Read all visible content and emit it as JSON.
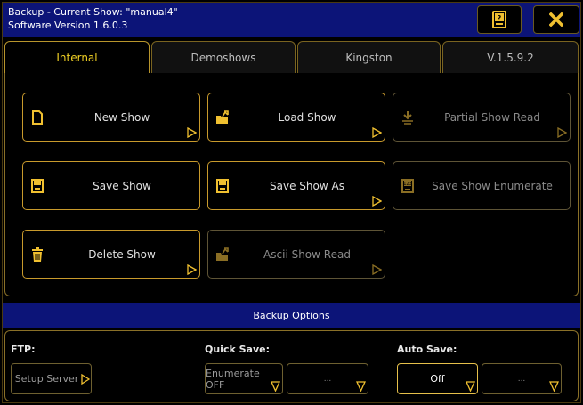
{
  "window": {
    "title_line1": "Backup - Current Show: \"manual4\"",
    "title_line2": "Software Version 1.6.0.3"
  },
  "tabs": [
    {
      "label": "Internal",
      "active": true
    },
    {
      "label": "Demoshows",
      "active": false
    },
    {
      "label": "Kingston",
      "active": false
    },
    {
      "label": "V.1.5.9.2",
      "active": false
    }
  ],
  "buttons": {
    "new_show": "New Show",
    "load_show": "Load Show",
    "partial_show_read": "Partial Show Read",
    "save_show": "Save Show",
    "save_show_as": "Save Show As",
    "save_show_enumerate": "Save Show Enumerate",
    "delete_show": "Delete Show",
    "ascii_show_read": "Ascii Show Read"
  },
  "options": {
    "bar_label": "Backup Options",
    "ftp_label": "FTP:",
    "setup_server": "Setup Server",
    "quick_save_label": "Quick Save:",
    "enumerate": "Enumerate OFF",
    "quick_save_value": "...",
    "auto_save_label": "Auto Save:",
    "auto_save_off": "Off",
    "auto_save_value": "..."
  },
  "colors": {
    "title_bar": "#0c1478",
    "accent_border": "#c89a2c",
    "active_tab_text": "#f0d024",
    "icon_yellow": "#f0c030"
  }
}
